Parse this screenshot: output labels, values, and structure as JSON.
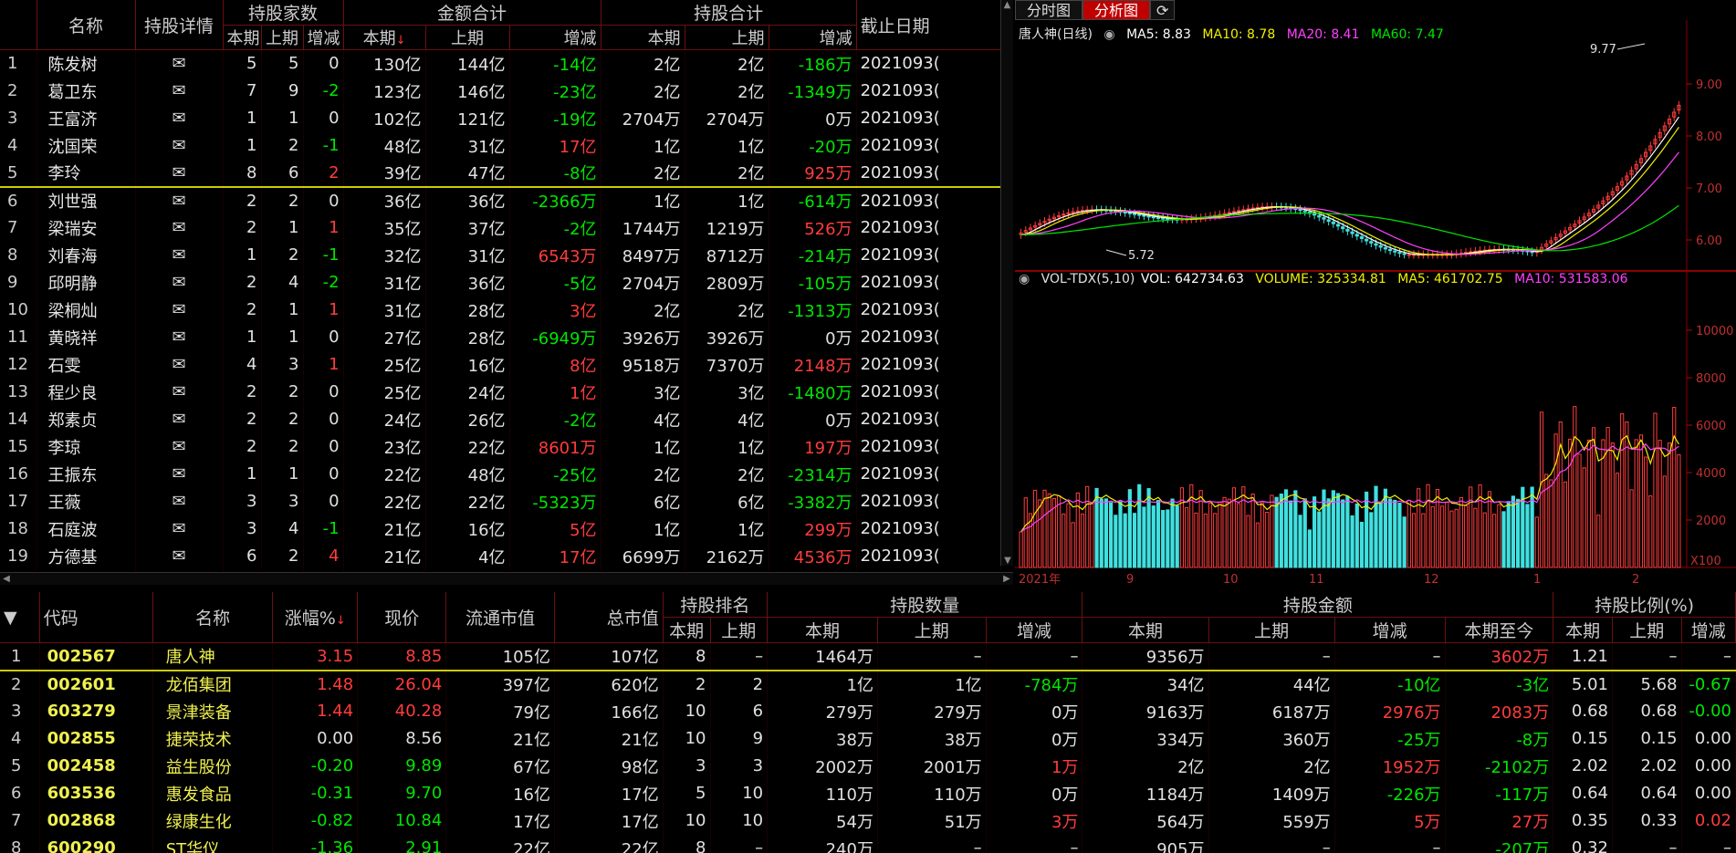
{
  "top": {
    "headers": {
      "name": "名称",
      "detail": "持股详情",
      "count_group": "持股家数",
      "amount_group": "金额合计",
      "hold_group": "持股合计",
      "date": "截止日期",
      "cur": "本期",
      "prev": "上期",
      "chg": "增减",
      "sort_indicator": "↓"
    },
    "rows": [
      {
        "i": "1",
        "n": "陈发树",
        "c": "5",
        "p": "5",
        "d": "0",
        "a": "130亿",
        "ap": "144亿",
        "ad": "-14亿",
        "h": "2亿",
        "hp": "2亿",
        "hd": "-186万",
        "dt": "2021093("
      },
      {
        "i": "2",
        "n": "葛卫东",
        "c": "7",
        "p": "9",
        "d": "-2",
        "a": "123亿",
        "ap": "146亿",
        "ad": "-23亿",
        "h": "2亿",
        "hp": "2亿",
        "hd": "-1349万",
        "dt": "2021093("
      },
      {
        "i": "3",
        "n": "王富济",
        "c": "1",
        "p": "1",
        "d": "0",
        "a": "102亿",
        "ap": "121亿",
        "ad": "-19亿",
        "h": "2704万",
        "hp": "2704万",
        "hd": "0万",
        "dt": "2021093("
      },
      {
        "i": "4",
        "n": "沈国荣",
        "c": "1",
        "p": "2",
        "d": "-1",
        "a": "48亿",
        "ap": "31亿",
        "ad": "17亿",
        "h": "1亿",
        "hp": "1亿",
        "hd": "-20万",
        "dt": "2021093("
      },
      {
        "i": "5",
        "n": "李玲",
        "c": "8",
        "p": "6",
        "d": "2",
        "a": "39亿",
        "ap": "47亿",
        "ad": "-8亿",
        "h": "2亿",
        "hp": "2亿",
        "hd": "925万",
        "dt": "2021093("
      },
      {
        "i": "6",
        "n": "刘世强",
        "c": "2",
        "p": "2",
        "d": "0",
        "a": "36亿",
        "ap": "36亿",
        "ad": "-2366万",
        "h": "1亿",
        "hp": "1亿",
        "hd": "-614万",
        "dt": "2021093("
      },
      {
        "i": "7",
        "n": "梁瑞安",
        "c": "2",
        "p": "1",
        "d": "1",
        "a": "35亿",
        "ap": "37亿",
        "ad": "-2亿",
        "h": "1744万",
        "hp": "1219万",
        "hd": "526万",
        "dt": "2021093("
      },
      {
        "i": "8",
        "n": "刘春海",
        "c": "1",
        "p": "2",
        "d": "-1",
        "a": "32亿",
        "ap": "31亿",
        "ad": "6543万",
        "h": "8497万",
        "hp": "8712万",
        "hd": "-214万",
        "dt": "2021093("
      },
      {
        "i": "9",
        "n": "邱明静",
        "c": "2",
        "p": "4",
        "d": "-2",
        "a": "31亿",
        "ap": "36亿",
        "ad": "-5亿",
        "h": "2704万",
        "hp": "2809万",
        "hd": "-105万",
        "dt": "2021093("
      },
      {
        "i": "10",
        "n": "梁桐灿",
        "c": "2",
        "p": "1",
        "d": "1",
        "a": "31亿",
        "ap": "28亿",
        "ad": "3亿",
        "h": "2亿",
        "hp": "2亿",
        "hd": "-1313万",
        "dt": "2021093("
      },
      {
        "i": "11",
        "n": "黄晓祥",
        "c": "1",
        "p": "1",
        "d": "0",
        "a": "27亿",
        "ap": "28亿",
        "ad": "-6949万",
        "h": "3926万",
        "hp": "3926万",
        "hd": "0万",
        "dt": "2021093("
      },
      {
        "i": "12",
        "n": "石雯",
        "c": "4",
        "p": "3",
        "d": "1",
        "a": "25亿",
        "ap": "16亿",
        "ad": "8亿",
        "h": "9518万",
        "hp": "7370万",
        "hd": "2148万",
        "dt": "2021093("
      },
      {
        "i": "13",
        "n": "程少良",
        "c": "2",
        "p": "2",
        "d": "0",
        "a": "25亿",
        "ap": "24亿",
        "ad": "1亿",
        "h": "3亿",
        "hp": "3亿",
        "hd": "-1480万",
        "dt": "2021093("
      },
      {
        "i": "14",
        "n": "郑素贞",
        "c": "2",
        "p": "2",
        "d": "0",
        "a": "24亿",
        "ap": "26亿",
        "ad": "-2亿",
        "h": "4亿",
        "hp": "4亿",
        "hd": "0万",
        "dt": "2021093("
      },
      {
        "i": "15",
        "n": "李琼",
        "c": "2",
        "p": "2",
        "d": "0",
        "a": "23亿",
        "ap": "22亿",
        "ad": "8601万",
        "h": "1亿",
        "hp": "1亿",
        "hd": "197万",
        "dt": "2021093("
      },
      {
        "i": "16",
        "n": "王振东",
        "c": "1",
        "p": "1",
        "d": "0",
        "a": "22亿",
        "ap": "48亿",
        "ad": "-25亿",
        "h": "2亿",
        "hp": "2亿",
        "hd": "-2314万",
        "dt": "2021093("
      },
      {
        "i": "17",
        "n": "王薇",
        "c": "3",
        "p": "3",
        "d": "0",
        "a": "22亿",
        "ap": "22亿",
        "ad": "-5323万",
        "h": "6亿",
        "hp": "6亿",
        "hd": "-3382万",
        "dt": "2021093("
      },
      {
        "i": "18",
        "n": "石庭波",
        "c": "3",
        "p": "4",
        "d": "-1",
        "a": "21亿",
        "ap": "16亿",
        "ad": "5亿",
        "h": "1亿",
        "hp": "1亿",
        "hd": "299万",
        "dt": "2021093("
      },
      {
        "i": "19",
        "n": "方德基",
        "c": "6",
        "p": "2",
        "d": "4",
        "a": "21亿",
        "ap": "4亿",
        "ad": "17亿",
        "h": "6699万",
        "hp": "2162万",
        "hd": "4536万",
        "dt": "2021093("
      }
    ]
  },
  "chart": {
    "tabs": [
      "分时图",
      "分析图"
    ],
    "title": "唐人神(日线)",
    "ma": {
      "ma5": "MA5: 8.83",
      "ma10": "MA10: 8.78",
      "ma20": "MA20: 8.41",
      "ma60": "MA60: 7.47"
    },
    "high_label": "9.77",
    "low_label": "5.72",
    "price_ticks": [
      "9.00",
      "8.00",
      "7.00",
      "6.00"
    ],
    "vol_title": "VOL-TDX(5,10)",
    "vol_vals": {
      "vol": "VOL: 642734.63",
      "volume": "VOLUME: 325334.81",
      "ma5": "MA5: 461702.75",
      "ma10": "MA10: 531583.06"
    },
    "vol_ticks": [
      "10000",
      "8000",
      "6000",
      "4000",
      "2000"
    ],
    "vol_unit": "X100",
    "x_labels": [
      "2021年",
      "9",
      "10",
      "11",
      "12",
      "1",
      "2"
    ],
    "colors": {
      "ma5": "#ffffff",
      "ma10": "#f0f000",
      "ma20": "#ff40ff",
      "ma60": "#00e600",
      "up": "#ff3c3c",
      "down": "#40e0e0"
    }
  },
  "bottom": {
    "headers": {
      "code": "代码",
      "name": "名称",
      "pct": "涨幅%",
      "price": "现价",
      "float_cap": "流通市值",
      "total_cap": "总市值",
      "rank_group": "持股排名",
      "qty_group": "持股数量",
      "amt_group": "持股金额",
      "ratio_group": "持股比例(%)",
      "cur": "本期",
      "prev": "上期",
      "chg": "增减",
      "to_now": "本期至今",
      "sort_indicator": "↓"
    },
    "rows": [
      {
        "i": "1",
        "code": "002567",
        "n": "唐人神",
        "pct": "3.15",
        "px": "8.85",
        "fc": "105亿",
        "tc": "107亿",
        "r": "8",
        "rp": "–",
        "q": "1464万",
        "qp": "–",
        "qd": "–",
        "m": "9356万",
        "mp": "–",
        "md": "–",
        "mn": "3602万",
        "s": "1.21",
        "sp": "–",
        "sd": "–"
      },
      {
        "i": "2",
        "code": "002601",
        "n": "龙佰集团",
        "pct": "1.48",
        "px": "26.04",
        "fc": "397亿",
        "tc": "620亿",
        "r": "2",
        "rp": "2",
        "q": "1亿",
        "qp": "1亿",
        "qd": "-784万",
        "m": "34亿",
        "mp": "44亿",
        "md": "-10亿",
        "mn": "-3亿",
        "s": "5.01",
        "sp": "5.68",
        "sd": "-0.67"
      },
      {
        "i": "3",
        "code": "603279",
        "n": "景津装备",
        "pct": "1.44",
        "px": "40.28",
        "fc": "79亿",
        "tc": "166亿",
        "r": "10",
        "rp": "6",
        "q": "279万",
        "qp": "279万",
        "qd": "0万",
        "m": "9163万",
        "mp": "6187万",
        "md": "2976万",
        "mn": "2083万",
        "s": "0.68",
        "sp": "0.68",
        "sd": "-0.00"
      },
      {
        "i": "4",
        "code": "002855",
        "n": "捷荣技术",
        "pct": "0.00",
        "px": "8.56",
        "fc": "21亿",
        "tc": "21亿",
        "r": "10",
        "rp": "9",
        "q": "38万",
        "qp": "38万",
        "qd": "0万",
        "m": "334万",
        "mp": "360万",
        "md": "-25万",
        "mn": "-8万",
        "s": "0.15",
        "sp": "0.15",
        "sd": "0.00"
      },
      {
        "i": "5",
        "code": "002458",
        "n": "益生股份",
        "pct": "-0.20",
        "px": "9.89",
        "fc": "67亿",
        "tc": "98亿",
        "r": "3",
        "rp": "3",
        "q": "2002万",
        "qp": "2001万",
        "qd": "1万",
        "m": "2亿",
        "mp": "2亿",
        "md": "1952万",
        "mn": "-2102万",
        "s": "2.02",
        "sp": "2.02",
        "sd": "0.00"
      },
      {
        "i": "6",
        "code": "603536",
        "n": "惠发食品",
        "pct": "-0.31",
        "px": "9.70",
        "fc": "16亿",
        "tc": "17亿",
        "r": "5",
        "rp": "10",
        "q": "110万",
        "qp": "110万",
        "qd": "0万",
        "m": "1184万",
        "mp": "1409万",
        "md": "-226万",
        "mn": "-117万",
        "s": "0.64",
        "sp": "0.64",
        "sd": "0.00"
      },
      {
        "i": "7",
        "code": "002868",
        "n": "绿康生化",
        "pct": "-0.82",
        "px": "10.84",
        "fc": "17亿",
        "tc": "17亿",
        "r": "10",
        "rp": "10",
        "q": "54万",
        "qp": "51万",
        "qd": "3万",
        "m": "564万",
        "mp": "559万",
        "md": "5万",
        "mn": "27万",
        "s": "0.35",
        "sp": "0.33",
        "sd": "0.02"
      },
      {
        "i": "8",
        "code": "600290",
        "n": "ST华仪",
        "pct": "-1.36",
        "px": "2.91",
        "fc": "22亿",
        "tc": "22亿",
        "r": "8",
        "rp": "–",
        "q": "240万",
        "qp": "–",
        "qd": "–",
        "m": "905万",
        "mp": "–",
        "md": "–",
        "mn": "-207万",
        "s": "0.32",
        "sp": "–",
        "sd": "–"
      }
    ]
  }
}
